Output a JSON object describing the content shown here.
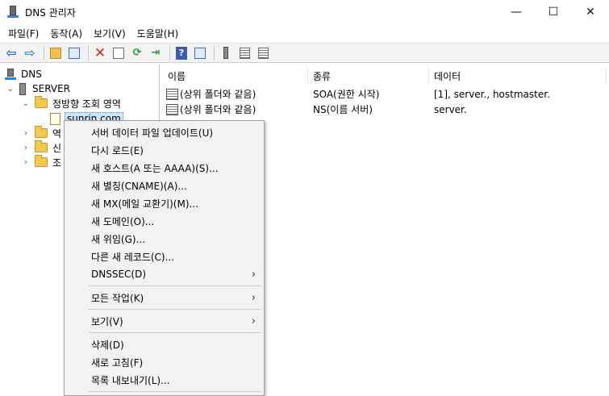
{
  "window": {
    "title": "DNS 관리자",
    "controls": {
      "minimize": "—",
      "maximize": "☐",
      "close": "✕"
    }
  },
  "menubar": [
    "파일(F)",
    "동작(A)",
    "보기(V)",
    "도움말(H)"
  ],
  "toolbar": {
    "icons": [
      "back-icon",
      "forward-icon",
      "up-folder-icon",
      "show-hide-tree-icon",
      "delete-icon",
      "properties-icon",
      "refresh-icon",
      "export-icon",
      "help-icon",
      "mmc-pane-icon",
      "server-icon",
      "list-icon",
      "details-icon"
    ]
  },
  "tree": {
    "root": "DNS",
    "server": "SERVER",
    "forward_zone": "정방향 조회 영역",
    "zone": "sunrin.com",
    "collapsed": [
      "역",
      "신",
      "조"
    ]
  },
  "list": {
    "columns": [
      "이름",
      "종류",
      "데이터"
    ],
    "rows": [
      {
        "name": "(상위 폴더와 같음)",
        "type": "SOA(권한 시작)",
        "data": "[1], server., hostmaster."
      },
      {
        "name": "(상위 폴더와 같음)",
        "type": "NS(이름 서버)",
        "data": "server."
      }
    ]
  },
  "context_menu": {
    "items": [
      {
        "label": "서버 데이터 파일 업데이트(U)"
      },
      {
        "label": "다시 로드(E)"
      },
      {
        "label": "새 호스트(A 또는 AAAA)(S)..."
      },
      {
        "label": "새 별칭(CNAME)(A)..."
      },
      {
        "label": "새 MX(메일 교환기)(M)..."
      },
      {
        "label": "새 도메인(O)..."
      },
      {
        "label": "새 위임(G)..."
      },
      {
        "label": "다른 새 레코드(C)..."
      },
      {
        "label": "DNSSEC(D)",
        "submenu": "›"
      },
      {
        "label": "모든 작업(K)",
        "submenu": "›"
      },
      {
        "label": "보기(V)",
        "submenu": "›"
      },
      {
        "label": "삭제(D)"
      },
      {
        "label": "새로 고침(F)"
      },
      {
        "label": "목록 내보내기(L)..."
      }
    ]
  }
}
